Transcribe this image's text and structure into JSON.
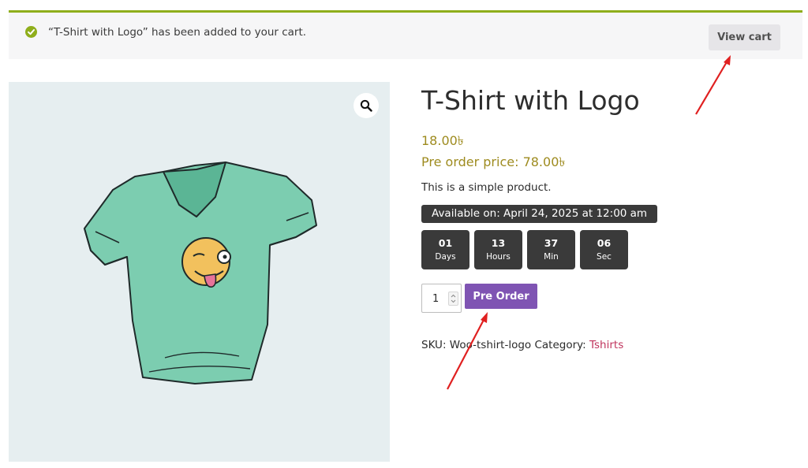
{
  "notice": {
    "icon": "check-circle-icon",
    "message": "“T-Shirt with Logo” has been added to your cart.",
    "view_cart_label": "View cart"
  },
  "gallery": {
    "zoom_icon": "magnifier-icon"
  },
  "product": {
    "title": "T-Shirt with Logo",
    "price": "18.00৳",
    "preorder_price": "Pre order price: 78.00৳",
    "description": "This is a simple product.",
    "available_on": "Available on: April 24, 2025 at 12:00 am",
    "countdown": [
      {
        "value": "01",
        "label": "Days"
      },
      {
        "value": "13",
        "label": "Hours"
      },
      {
        "value": "37",
        "label": "Min"
      },
      {
        "value": "06",
        "label": "Sec"
      }
    ],
    "quantity": "1",
    "preorder_button": "Pre Order",
    "sku_label": "SKU:",
    "sku": "Woo-tshirt-logo",
    "category_label": "Category:",
    "category": "Tshirts"
  },
  "colors": {
    "notice_border": "#8fae1b",
    "price": "#9e8b1f",
    "preorder_button": "#7f54b3",
    "category_link": "#c0345d",
    "annotation_arrow": "#e02020"
  }
}
